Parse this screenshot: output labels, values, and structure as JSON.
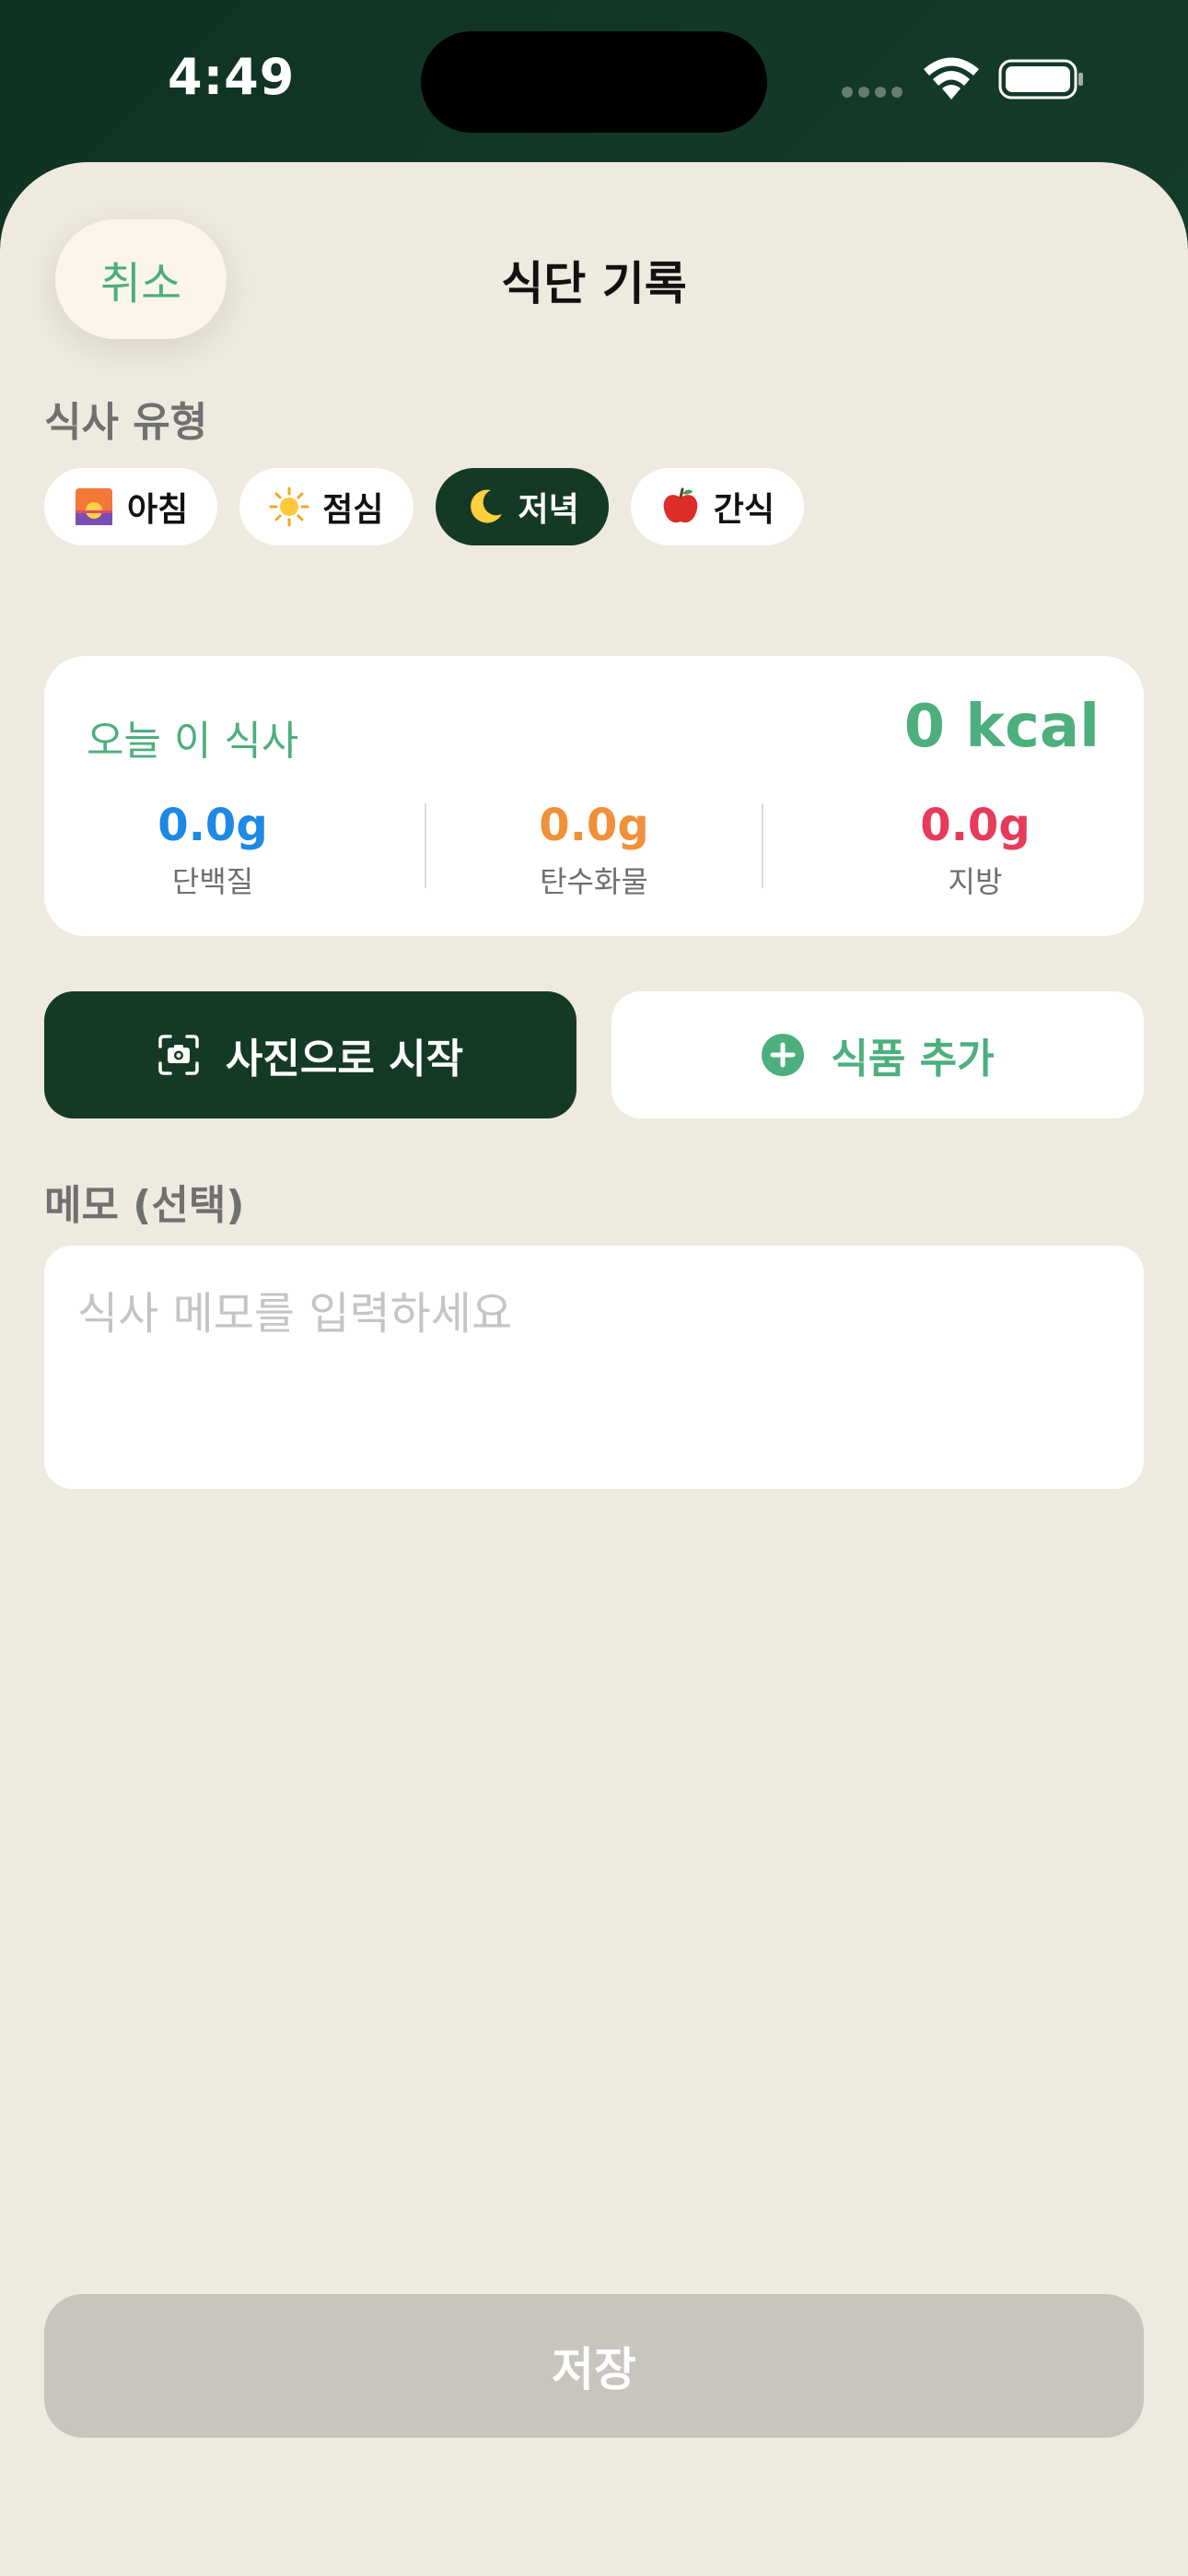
{
  "status": {
    "time": "4:49"
  },
  "header": {
    "cancel_label": "취소",
    "title": "식단 기록"
  },
  "meal_type": {
    "label": "식사 유형",
    "selected": "저녁",
    "options": [
      {
        "icon": "sunrise-icon",
        "label": "아침"
      },
      {
        "icon": "sun-icon",
        "label": "점심"
      },
      {
        "icon": "moon-icon",
        "label": "저녁"
      },
      {
        "icon": "apple-icon",
        "label": "간식"
      }
    ]
  },
  "summary": {
    "title": "오늘 이 식사",
    "kcal": "0 kcal",
    "macros": [
      {
        "value": "0.0g",
        "label": "단백질",
        "color": "#1e88e5"
      },
      {
        "value": "0.0g",
        "label": "탄수화물",
        "color": "#f0903a"
      },
      {
        "value": "0.0g",
        "label": "지방",
        "color": "#e83a5a"
      }
    ]
  },
  "actions": {
    "photo_label": "사진으로 시작",
    "add_label": "식품 추가"
  },
  "memo": {
    "label": "메모 (선택)",
    "value": "",
    "placeholder": "식사 메모를 입력하세요"
  },
  "save_label": "저장",
  "colors": {
    "accent": "#4caf7d",
    "dark": "#143a26",
    "background": "#eeeae0"
  }
}
